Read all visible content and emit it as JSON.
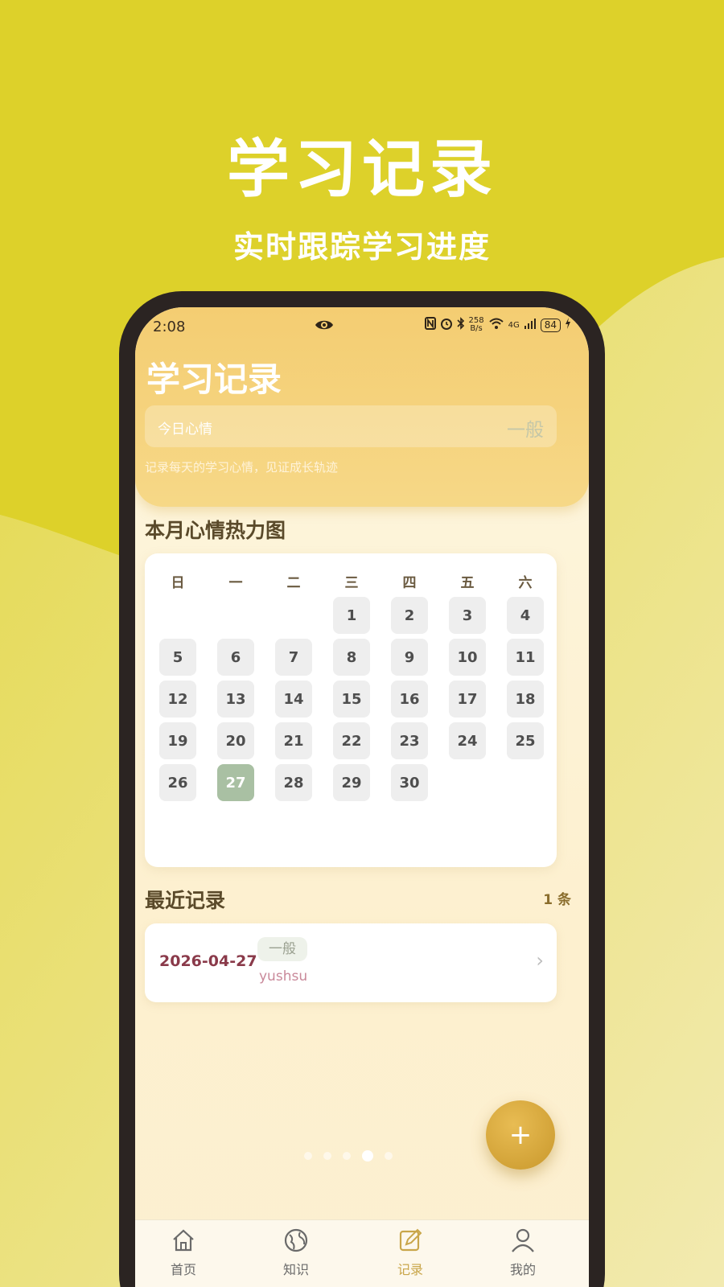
{
  "promo": {
    "title": "学习记录",
    "subtitle": "实时跟踪学习进度"
  },
  "status_bar": {
    "time": "2:08",
    "net_speed_top": "258",
    "net_speed_bottom": "B/s",
    "signal_label": "4G",
    "battery": "84"
  },
  "header": {
    "title": "学习记录",
    "mood_label": "今日心情",
    "mood_value": "一般",
    "hint": "记录每天的学习心情，见证成长轨迹"
  },
  "calendar": {
    "section_title": "本月心情热力图",
    "weekdays": [
      "日",
      "一",
      "二",
      "三",
      "四",
      "五",
      "六"
    ],
    "first_weekday_index": 3,
    "days": [
      "1",
      "2",
      "3",
      "4",
      "5",
      "6",
      "7",
      "8",
      "9",
      "10",
      "11",
      "12",
      "13",
      "14",
      "15",
      "16",
      "17",
      "18",
      "19",
      "20",
      "21",
      "22",
      "23",
      "24",
      "25",
      "26",
      "27",
      "28",
      "29",
      "30"
    ],
    "highlighted_day": "27"
  },
  "recent": {
    "section_title": "最近记录",
    "count": "1 条",
    "records": [
      {
        "date": "2026-04-27",
        "mood": "一般",
        "user": "yushsu"
      }
    ]
  },
  "fab": {
    "label": "+"
  },
  "bottom_nav": {
    "items": [
      {
        "label": "首页",
        "icon": "home-icon"
      },
      {
        "label": "知识",
        "icon": "globe-icon"
      },
      {
        "label": "记录",
        "icon": "edit-icon"
      },
      {
        "label": "我的",
        "icon": "user-icon"
      }
    ],
    "active_index": 2
  },
  "colors": {
    "background": "#ddd12a",
    "header_gradient_top": "#f4cd72",
    "today_cell": "#a9c0a3",
    "fab": "#d4a53a",
    "date_text": "#8a3a4a"
  }
}
